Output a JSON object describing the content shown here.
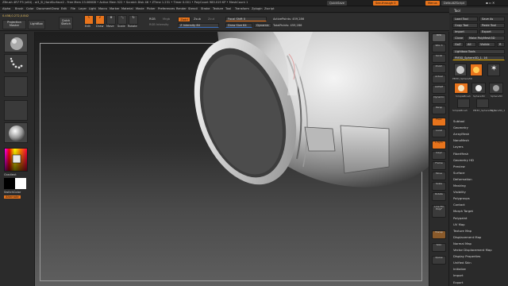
{
  "titlebar": {
    "app_info": "ZBrush 4R7 P3 (x64) - ai3_SI_HardSurface2 - Free Mem 23.066GB • Active Mem 522 • Scratch Disk 46 • ZTime 1.231 • Timer 0.001 • PolyCount 983.019 KP • MeshCount 1",
    "quicksave": "QuickSave",
    "seethrough": "See-through 0",
    "menus": "Menus",
    "default_script": "DefaultZScript"
  },
  "menubar": {
    "items": [
      "Alpha",
      "Brush",
      "Color",
      "Document",
      "Draw",
      "Edit",
      "File",
      "Layer",
      "Light",
      "Macro",
      "Marker",
      "Material",
      "Movie",
      "Picker",
      "Preferences",
      "Render",
      "Stencil",
      "Stroke",
      "Texture",
      "Tool",
      "Transform",
      "Zplugin",
      "Zscript"
    ]
  },
  "toolbar": {
    "coords": "0.458,0.272,0.842",
    "projection_master": "Projection Master",
    "lightbox": "LightBox",
    "quick_sketch": "Quick Sketch",
    "edit": "Edit",
    "draw": "Draw",
    "move": "Move",
    "scale": "Scale",
    "rotate": "Rotate",
    "rgb": "RGB",
    "rgb_intensity": "RGB Intensity",
    "mrgb": "Mrgb",
    "zadd": "Zadd",
    "zsub": "Zsub",
    "zcut": "Zcut",
    "z_intensity": "Z Intensity 84",
    "focal_shift": "Focal Shift 0",
    "draw_size": "Draw Size 64",
    "dynamic": "Dynamic",
    "active_points": "ActivePoints: 459,286",
    "total_points": "TotalPoints: 459,286"
  },
  "leftshelf": {
    "gradient": "Gradient",
    "switch_color": "SwitchColor",
    "alternate": "Alternate"
  },
  "rightshelf": {
    "buttons": [
      "BPR",
      "SPix 3",
      "Scroll",
      "Zoom",
      "Actual",
      "AAHalf",
      "Dynamic",
      "Persp",
      "Floor",
      "Local",
      "L.Sym",
      "Gxyz",
      "Frame",
      "Move",
      "Scale",
      "Rotate",
      "Line Fill PolyF",
      "Transp",
      "Solo",
      "Xpose"
    ]
  },
  "palette": {
    "title": "Tool",
    "load_tool": "Load Tool",
    "save_as": "Save As",
    "copy_tool": "Copy Tool",
    "paste_tool": "Paste Tool",
    "import": "Import",
    "export": "Export",
    "clone": "Clone",
    "make_polymesh": "Make PolyMesh3D",
    "goz": "GoZ",
    "all": "All",
    "visible": "Visible",
    "r": "R",
    "lightbox_tools": "Lightbox›Tools",
    "current_tool": "PM3D_Sphere3D_1. 16",
    "thumbs": [
      "PM3D_Sphere3D",
      "SimpleBrush",
      "Sphere3D",
      "Sphere3D",
      "SimpleBrush",
      "PM3D_Sphere3D_1",
      "Sphere3D_1"
    ],
    "sections": [
      "Subtool",
      "Geometry",
      "ArrayMesh",
      "NanoMesh",
      "Layers",
      "FiberMesh",
      "Geometry HD",
      "Preview",
      "Surface",
      "Deformation",
      "Masking",
      "Visibility",
      "Polygroups",
      "Contact",
      "Morph Target",
      "Polypaint",
      "UV Map",
      "Texture Map",
      "Displacement Map",
      "Normal Map",
      "Vector Displacement Map",
      "Display Properties",
      "Unified Skin",
      "Initialize",
      "Import",
      "Export"
    ]
  },
  "colors": {
    "accent_orange": "#e8741c",
    "highlight_yellow": "#d8a500",
    "active_blue": "#3a6fc0"
  }
}
